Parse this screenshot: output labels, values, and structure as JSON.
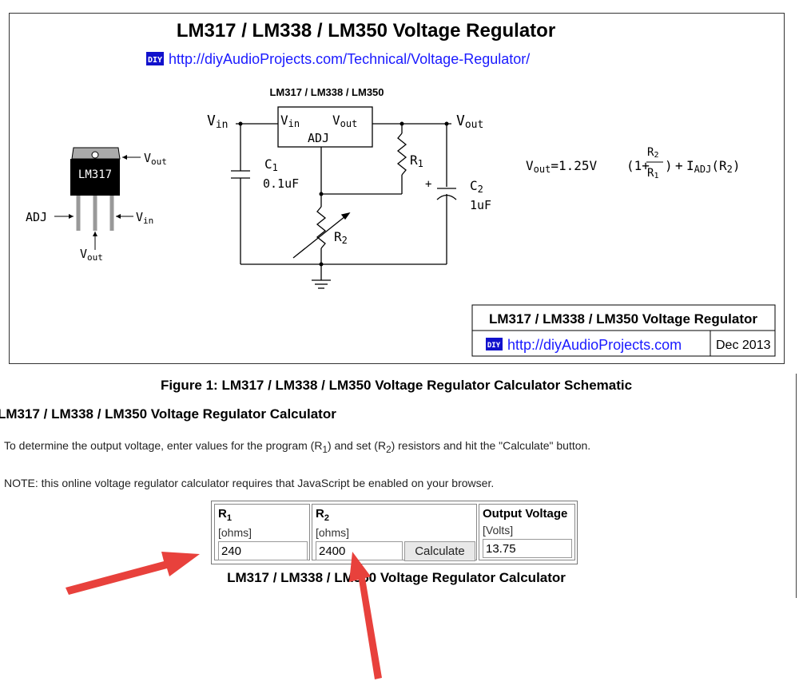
{
  "schematic": {
    "title": "LM317 / LM338 / LM350 Voltage Regulator",
    "url": "http://diyAudioProjects.com/Technical/Voltage-Regulator/",
    "diy_badge": "DIY",
    "chip_header": "LM317 / LM338 / LM350",
    "package_label": "LM317",
    "pins": {
      "vout_top": "V",
      "vout_top_sub": "out",
      "adj": "ADJ",
      "vin": "V",
      "vin_sub": "in",
      "vout_bottom": "V",
      "vout_bottom_sub": "out"
    },
    "regulator": {
      "vin": "V",
      "vin_sub": "in",
      "vout": "V",
      "vout_sub": "out",
      "adj": "ADJ"
    },
    "labels": {
      "vin": "V",
      "vin_sub": "in",
      "vout": "V",
      "vout_sub": "out",
      "c1": "C",
      "c1_sub": "1",
      "c1_value": "0.1uF",
      "c2": "C",
      "c2_sub": "2",
      "c2_value": "1uF",
      "r1": "R",
      "r1_sub": "1",
      "r2": "R",
      "r2_sub": "2",
      "plus": "+"
    },
    "formula": {
      "lhs": "V",
      "lhs_sub": "out",
      "eq": "=1.25V",
      "open": "(1+",
      "num": "R",
      "num_sub": "2",
      "den": "R",
      "den_sub": "1",
      "close": ")",
      "plus": "+",
      "iadj": "I",
      "iadj_sub": "ADJ",
      "tail": "(R",
      "tail_sub": "2",
      "tail_close": ")"
    },
    "title_block": {
      "title": "LM317 / LM338 / LM350 Voltage Regulator",
      "url": "http://diyAudioProjects.com",
      "date": "Dec 2013"
    }
  },
  "figure_caption": "Figure 1: LM317 / LM338 / LM350 Voltage Regulator Calculator Schematic",
  "calculator": {
    "heading": "LM317 / LM338 / LM350 Voltage Regulator Calculator",
    "intro": {
      "a": "To determine the output voltage, enter values for the program (R",
      "a_sub": "1",
      "b": ") and set (R",
      "b_sub": "2",
      "c": ") resistors and hit the \"Calculate\" button."
    },
    "note": "NOTE: this online voltage regulator calculator requires that JavaScript be enabled on your browser.",
    "r1": {
      "label": "R",
      "label_sub": "1",
      "unit": "[ohms]",
      "value": "240"
    },
    "r2": {
      "label": "R",
      "label_sub": "2",
      "unit": "[ohms]",
      "value": "2400"
    },
    "calculate_label": "Calculate",
    "output": {
      "label": "Output Voltage",
      "unit": "[Volts]",
      "value": "13.75"
    },
    "caption": "LM317 / LM338 / LM350 Voltage Regulator Calculator"
  },
  "annotation_colors": {
    "arrow": "#e8413c"
  }
}
